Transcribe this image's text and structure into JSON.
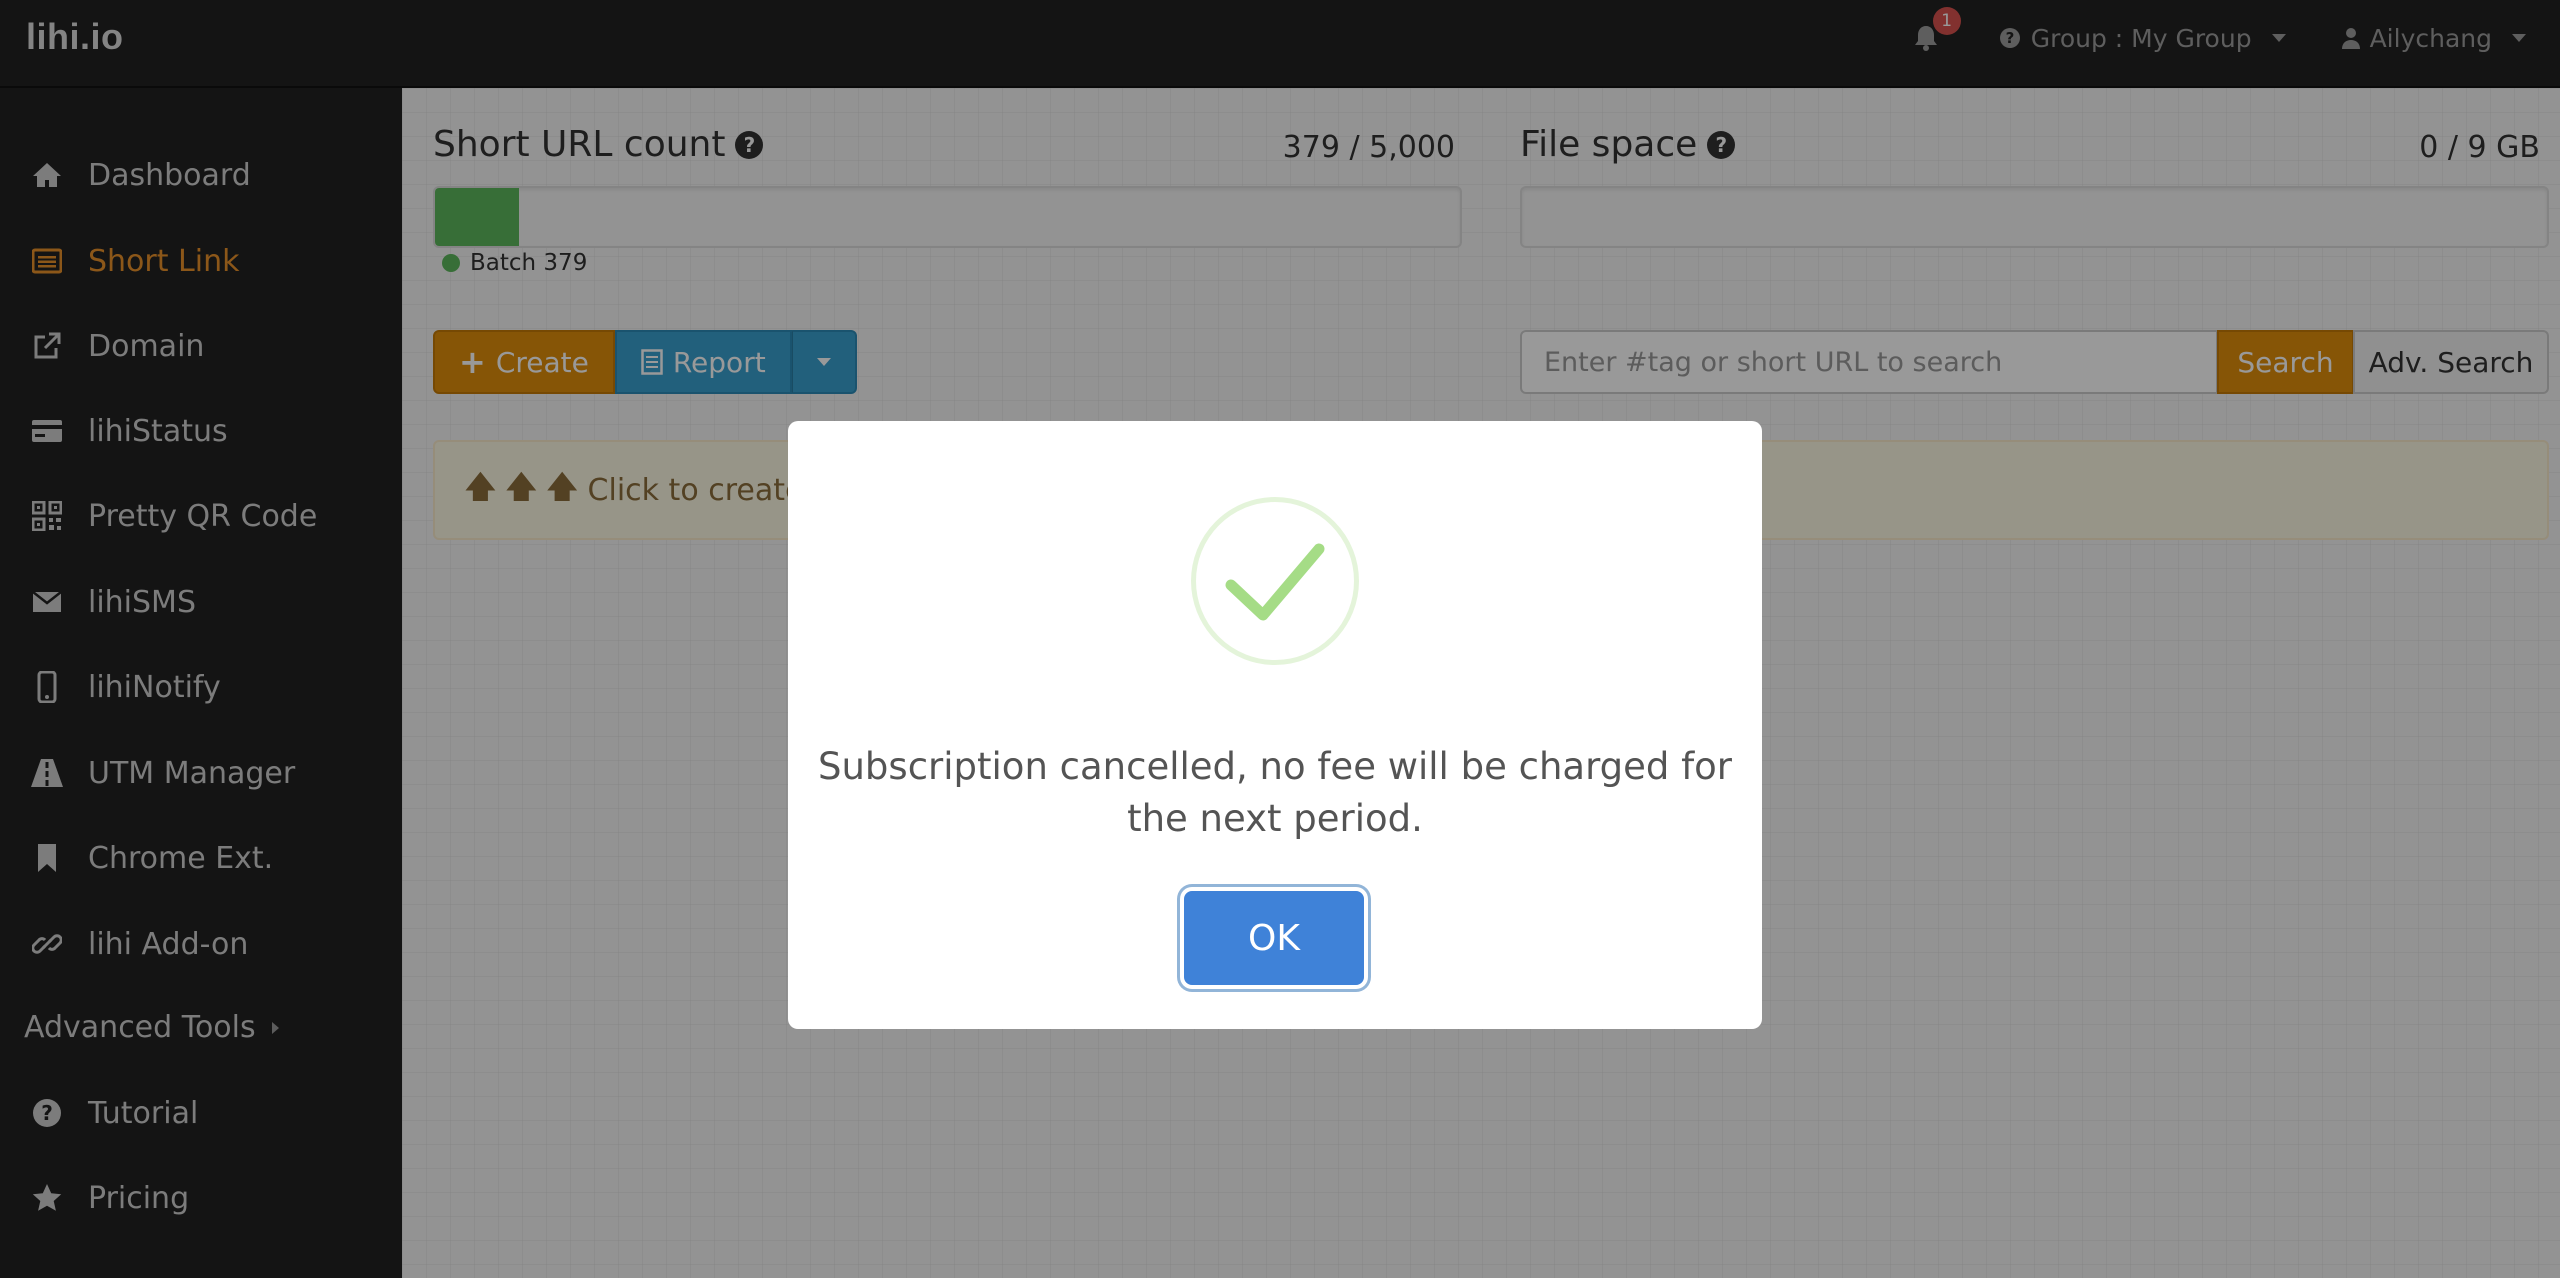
{
  "topbar": {
    "brand": "lihi.io",
    "notification_count": "1",
    "group_label": "Group : My Group",
    "user_label": "Ailychang"
  },
  "sidebar": {
    "items": [
      {
        "label": "Dashboard",
        "icon": "home-icon"
      },
      {
        "label": "Short Link",
        "icon": "list-icon",
        "active": true
      },
      {
        "label": "Domain",
        "icon": "external-link-icon"
      },
      {
        "label": "lihiStatus",
        "icon": "credit-card-icon"
      },
      {
        "label": "Pretty QR Code",
        "icon": "qrcode-icon"
      },
      {
        "label": "lihiSMS",
        "icon": "envelope-icon"
      },
      {
        "label": "lihiNotify",
        "icon": "mobile-icon"
      },
      {
        "label": "UTM Manager",
        "icon": "road-icon"
      },
      {
        "label": "Chrome Ext.",
        "icon": "bookmark-icon"
      },
      {
        "label": "lihi Add-on",
        "icon": "link-icon"
      }
    ],
    "advanced_tools": "Advanced Tools",
    "bottom_items": [
      {
        "label": "Tutorial",
        "icon": "question-circle-icon"
      },
      {
        "label": "Pricing",
        "icon": "star-icon"
      }
    ]
  },
  "stats": {
    "short_url": {
      "title": "Short URL count",
      "count": "379 / 5,000",
      "used": 379,
      "total": 5000,
      "legend": "Batch 379"
    },
    "file_space": {
      "title": "File space",
      "count": "0 / 9 GB",
      "used": 0,
      "total": 9
    }
  },
  "toolbar": {
    "create_label": "Create",
    "report_label": "Report",
    "search_placeholder": "Enter #tag or short URL to search",
    "search_label": "Search",
    "adv_search_label": "Adv. Search"
  },
  "hint": {
    "text": "Click to create"
  },
  "modal": {
    "message": "Subscription cancelled, no fee will be charged for the next period.",
    "ok_label": "OK"
  },
  "colors": {
    "accent": "#e08e0b",
    "info": "#3aa0cf",
    "success": "#5cb85c",
    "modal_button": "#3f82d8"
  }
}
